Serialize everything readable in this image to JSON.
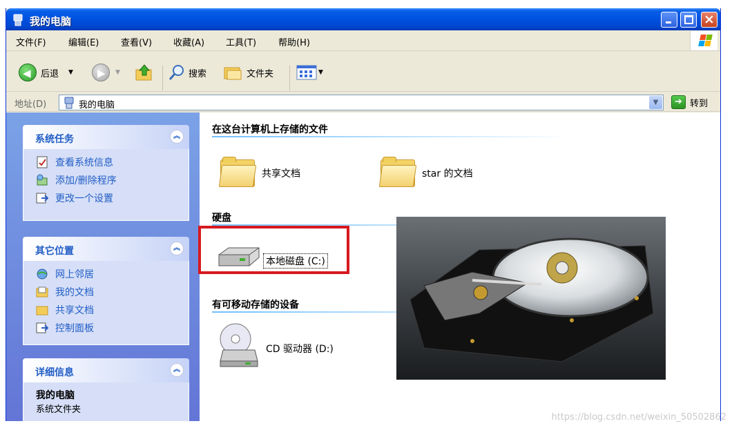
{
  "window": {
    "title": "我的电脑"
  },
  "menubar": [
    "文件(F)",
    "编辑(E)",
    "查看(V)",
    "收藏(A)",
    "工具(T)",
    "帮助(H)"
  ],
  "toolbar": {
    "back_label": "后退",
    "search_label": "搜索",
    "folders_label": "文件夹"
  },
  "address": {
    "label": "地址(D)",
    "value": "我的电脑",
    "go_label": "转到"
  },
  "left_panel": {
    "system_tasks": {
      "title": "系统任务",
      "items": [
        "查看系统信息",
        "添加/删除程序",
        "更改一个设置"
      ]
    },
    "other_places": {
      "title": "其它位置",
      "items": [
        "网上邻居",
        "我的文档",
        "共享文档",
        "控制面板"
      ]
    },
    "details": {
      "title": "详细信息",
      "name": "我的电脑",
      "type": "系统文件夹"
    }
  },
  "main": {
    "groups": [
      {
        "title": "在这台计算机上存储的文件",
        "items": [
          "共享文档",
          "star 的文档"
        ]
      },
      {
        "title": "硬盘",
        "items": [
          "本地磁盘 (C:)"
        ]
      },
      {
        "title": "有可移动存储的设备",
        "items": [
          "CD 驱动器 (D:)"
        ]
      }
    ]
  },
  "watermark": "https://blog.csdn.net/weixin_50502862",
  "colors": {
    "title_bar": "#0054e3",
    "left_pane": "#7ba2e7",
    "link_text": "#215dc6",
    "highlight": "#d7191f"
  }
}
